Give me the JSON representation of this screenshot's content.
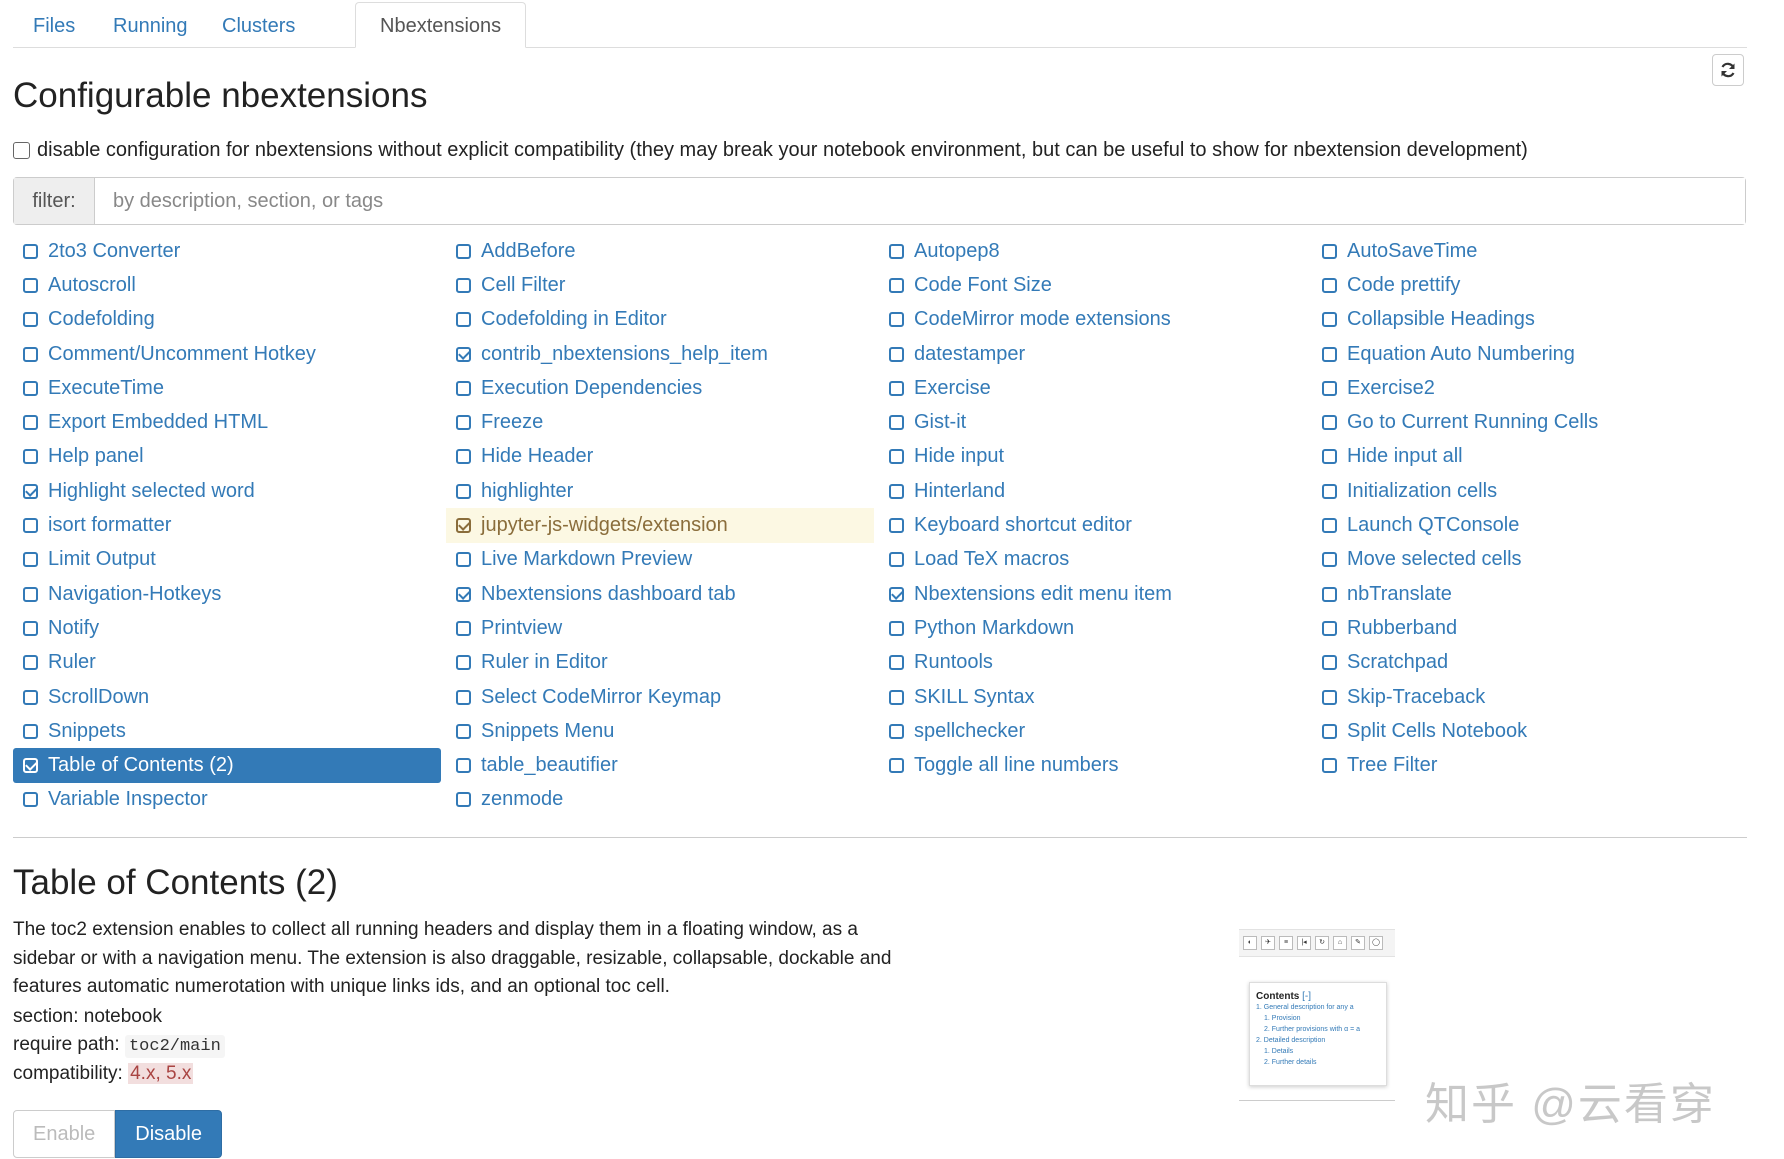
{
  "tabs": [
    {
      "label": "Files"
    },
    {
      "label": "Running"
    },
    {
      "label": "Clusters"
    },
    {
      "label": "Nbextensions"
    }
  ],
  "heading": "Configurable nbextensions",
  "compat_label": "disable configuration for nbextensions without explicit compatibility (they may break your notebook environment, but can be useful to show for nbextension development)",
  "filter": {
    "label": "filter:",
    "placeholder": "by description, section, or tags"
  },
  "extensions": [
    {
      "label": "2to3 Converter",
      "checked": false
    },
    {
      "label": "AddBefore",
      "checked": false
    },
    {
      "label": "Autopep8",
      "checked": false
    },
    {
      "label": "AutoSaveTime",
      "checked": false
    },
    {
      "label": "Autoscroll",
      "checked": false
    },
    {
      "label": "Cell Filter",
      "checked": false
    },
    {
      "label": "Code Font Size",
      "checked": false
    },
    {
      "label": "Code prettify",
      "checked": false
    },
    {
      "label": "Codefolding",
      "checked": false
    },
    {
      "label": "Codefolding in Editor",
      "checked": false
    },
    {
      "label": "CodeMirror mode extensions",
      "checked": false
    },
    {
      "label": "Collapsible Headings",
      "checked": false
    },
    {
      "label": "Comment/Uncomment Hotkey",
      "checked": false
    },
    {
      "label": "contrib_nbextensions_help_item",
      "checked": true
    },
    {
      "label": "datestamper",
      "checked": false
    },
    {
      "label": "Equation Auto Numbering",
      "checked": false
    },
    {
      "label": "ExecuteTime",
      "checked": false
    },
    {
      "label": "Execution Dependencies",
      "checked": false
    },
    {
      "label": "Exercise",
      "checked": false
    },
    {
      "label": "Exercise2",
      "checked": false
    },
    {
      "label": "Export Embedded HTML",
      "checked": false
    },
    {
      "label": "Freeze",
      "checked": false
    },
    {
      "label": "Gist-it",
      "checked": false
    },
    {
      "label": "Go to Current Running Cells",
      "checked": false
    },
    {
      "label": "Help panel",
      "checked": false
    },
    {
      "label": "Hide Header",
      "checked": false
    },
    {
      "label": "Hide input",
      "checked": false
    },
    {
      "label": "Hide input all",
      "checked": false
    },
    {
      "label": "Highlight selected word",
      "checked": true
    },
    {
      "label": "highlighter",
      "checked": false
    },
    {
      "label": "Hinterland",
      "checked": false
    },
    {
      "label": "Initialization cells",
      "checked": false
    },
    {
      "label": "isort formatter",
      "checked": false
    },
    {
      "label": "jupyter-js-widgets/extension",
      "checked": true,
      "state": "warn"
    },
    {
      "label": "Keyboard shortcut editor",
      "checked": false
    },
    {
      "label": "Launch QTConsole",
      "checked": false
    },
    {
      "label": "Limit Output",
      "checked": false
    },
    {
      "label": "Live Markdown Preview",
      "checked": false
    },
    {
      "label": "Load TeX macros",
      "checked": false
    },
    {
      "label": "Move selected cells",
      "checked": false
    },
    {
      "label": "Navigation-Hotkeys",
      "checked": false
    },
    {
      "label": "Nbextensions dashboard tab",
      "checked": true
    },
    {
      "label": "Nbextensions edit menu item",
      "checked": true
    },
    {
      "label": "nbTranslate",
      "checked": false
    },
    {
      "label": "Notify",
      "checked": false
    },
    {
      "label": "Printview",
      "checked": false
    },
    {
      "label": "Python Markdown",
      "checked": false
    },
    {
      "label": "Rubberband",
      "checked": false
    },
    {
      "label": "Ruler",
      "checked": false
    },
    {
      "label": "Ruler in Editor",
      "checked": false
    },
    {
      "label": "Runtools",
      "checked": false
    },
    {
      "label": "Scratchpad",
      "checked": false
    },
    {
      "label": "ScrollDown",
      "checked": false
    },
    {
      "label": "Select CodeMirror Keymap",
      "checked": false
    },
    {
      "label": "SKILL Syntax",
      "checked": false
    },
    {
      "label": "Skip-Traceback",
      "checked": false
    },
    {
      "label": "Snippets",
      "checked": false
    },
    {
      "label": "Snippets Menu",
      "checked": false
    },
    {
      "label": "spellchecker",
      "checked": false
    },
    {
      "label": "Split Cells Notebook",
      "checked": false
    },
    {
      "label": "Table of Contents (2)",
      "checked": true,
      "state": "selected"
    },
    {
      "label": "table_beautifier",
      "checked": false
    },
    {
      "label": "Toggle all line numbers",
      "checked": false
    },
    {
      "label": "Tree Filter",
      "checked": false
    },
    {
      "label": "Variable Inspector",
      "checked": false
    },
    {
      "label": "zenmode",
      "checked": false
    }
  ],
  "detail": {
    "title": "Table of Contents (2)",
    "description": "The toc2 extension enables to collect all running headers and display them in a floating window, as a sidebar or with a navigation menu. The extension is also draggable, resizable, collapsable, dockable and features automatic numerotation with unique links ids, and an optional toc cell.",
    "section_label": "section:",
    "section": "notebook",
    "require_label": "require path:",
    "require_path": "toc2/main",
    "compat_label": "compatibility:",
    "compatibility": "4.x, 5.x",
    "enable_label": "Enable",
    "disable_label": "Disable"
  },
  "preview": {
    "title": "Contents",
    "title_controls": "[-]",
    "items": [
      {
        "text": "1.  General description for any a",
        "level": 1
      },
      {
        "text": "1.  Provision",
        "level": 2
      },
      {
        "text": "2.  Further provisions with α = a",
        "level": 2
      },
      {
        "text": "2.  Detailed description",
        "level": 1
      },
      {
        "text": "1.  Details",
        "level": 2
      },
      {
        "text": "2.  Further details",
        "level": 2
      }
    ]
  },
  "watermark": "知乎 @云看穿",
  "icons": {
    "refresh": "refresh-icon",
    "checkbox": "checkbox-icon"
  },
  "colors": {
    "link": "#337ab7",
    "selected_bg": "#337ab7",
    "warning_bg": "#fcf8e3",
    "warning_text": "#8a6d3b"
  }
}
